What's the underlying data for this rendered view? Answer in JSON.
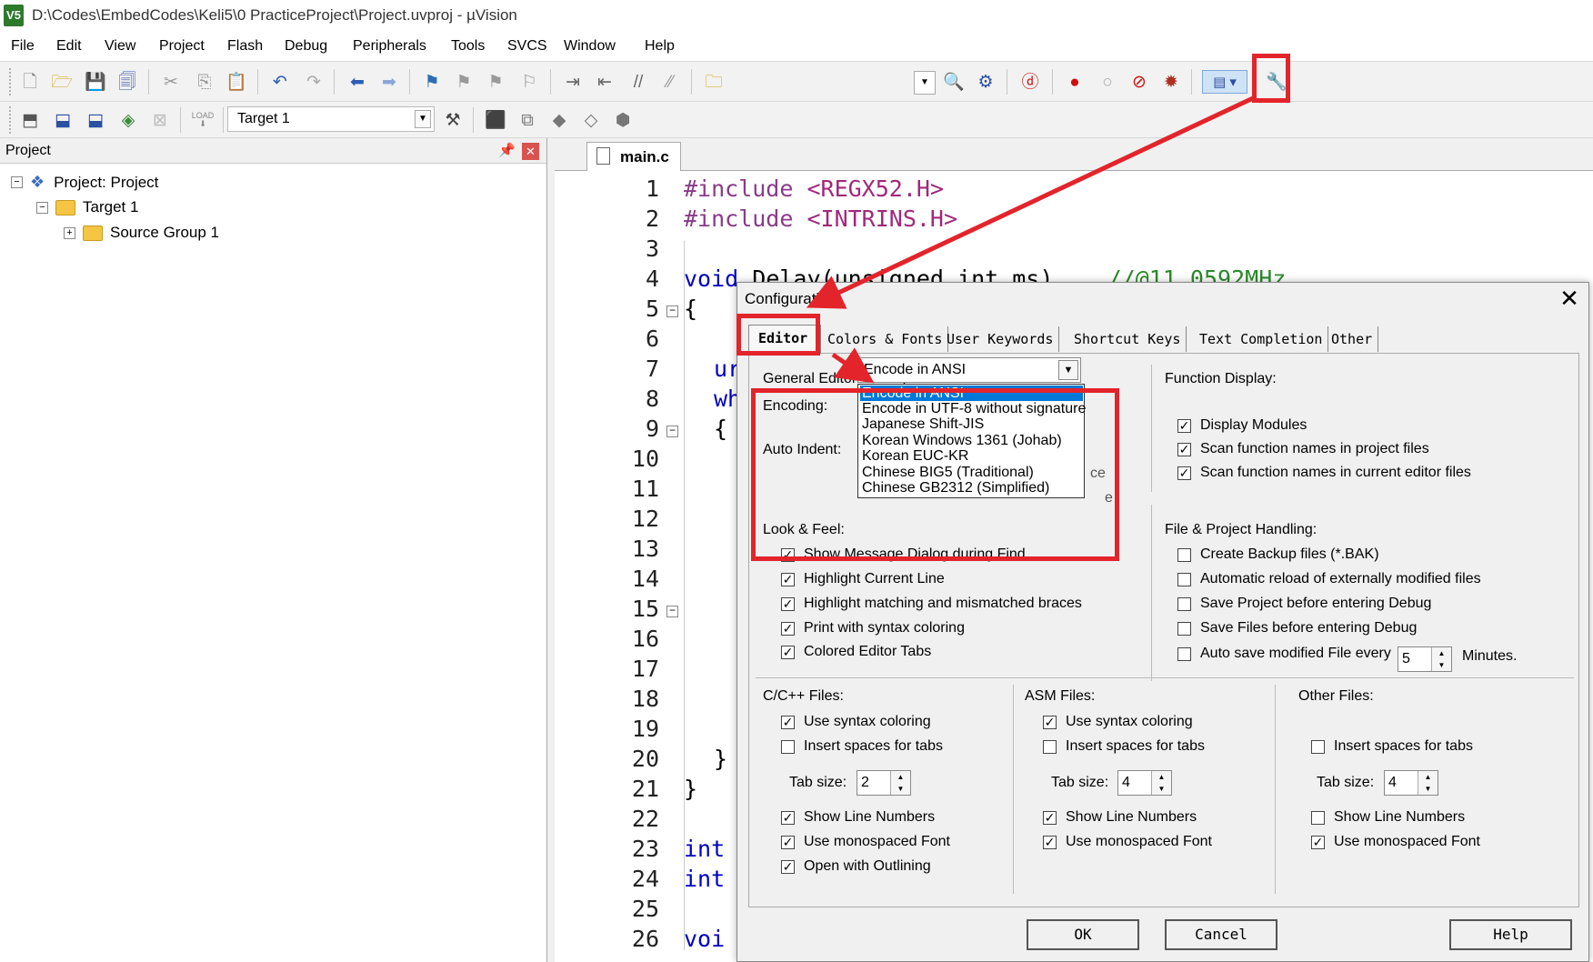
{
  "window": {
    "title": "D:\\Codes\\EmbedCodes\\Keli5\\0 PracticeProject\\Project.uvproj - µVision",
    "app_icon_text": "V5"
  },
  "menu": [
    "File",
    "Edit",
    "View",
    "Project",
    "Flash",
    "Debug",
    "Peripherals",
    "Tools",
    "SVCS",
    "Window",
    "Help"
  ],
  "toolbar2": {
    "target": "Target 1",
    "load_label": "LOAD"
  },
  "project_panel": {
    "title": "Project",
    "tree": [
      {
        "label": "Project: Project",
        "expander": "−"
      },
      {
        "label": "Target 1",
        "expander": "−"
      },
      {
        "label": "Source Group 1",
        "expander": "+"
      }
    ]
  },
  "editor": {
    "tab": "main.c",
    "line_numbers": [
      "1",
      "2",
      "3",
      "4",
      "5",
      "6",
      "7",
      "8",
      "9",
      "10",
      "11",
      "12",
      "13",
      "14",
      "15",
      "16",
      "17",
      "18",
      "19",
      "20",
      "21",
      "22",
      "23",
      "24",
      "25",
      "26"
    ],
    "code": {
      "l1_kw": "#include",
      "l1_rest": " <REGX52.H>",
      "l2_kw": "#include",
      "l2_rest": " <INTRINS.H>",
      "l4_kw": "void",
      "l4_rest": " Delay(unsigned int ms)",
      "l4_cmt": "//@11.0592MHz",
      "l5": "{",
      "l7": "ur",
      "l8": "wh",
      "l9": "{",
      "l20": "}",
      "l21": "}",
      "l23": "int",
      "l24": "int",
      "l26": "voi"
    }
  },
  "dialog": {
    "title": "Configuration",
    "close_glyph": "✕",
    "tabs": [
      "Editor",
      "Colors & Fonts",
      "User Keywords",
      "Shortcut Keys",
      "Text Completion",
      "Other"
    ],
    "general": {
      "title": "General Editor Settings:",
      "encoding_label": "Encoding:",
      "encoding_value": "Encode in ANSI",
      "auto_indent_label": "Auto Indent:",
      "encoding_options": [
        "Encode in ANSI",
        "Encode in UTF-8 without signature",
        "Japanese Shift-JIS",
        "Korean Windows 1361 (Johab)",
        "Korean EUC-KR",
        "Chinese BIG5 (Traditional)",
        "Chinese GB2312 (Simplified)"
      ],
      "partial_c": "ce",
      "partial_e": "e"
    },
    "function_display": {
      "title": "Function Display:",
      "items": [
        {
          "label": "Display Modules",
          "checked": true
        },
        {
          "label": "Scan function names in project files",
          "checked": true
        },
        {
          "label": "Scan function names in current editor files",
          "checked": true
        }
      ]
    },
    "look_feel": {
      "title": "Look & Feel:",
      "items": [
        {
          "label": "Show Message Dialog during Find",
          "checked": true
        },
        {
          "label": "Highlight Current Line",
          "checked": true
        },
        {
          "label": "Highlight matching and mismatched braces",
          "checked": true
        },
        {
          "label": "Print with syntax coloring",
          "checked": true
        },
        {
          "label": "Colored Editor Tabs",
          "checked": true
        }
      ]
    },
    "file_project": {
      "title": "File & Project Handling:",
      "items": [
        {
          "label": "Create Backup files (*.BAK)",
          "checked": false
        },
        {
          "label": "Automatic reload of externally modified files",
          "checked": false
        },
        {
          "label": "Save Project before entering Debug",
          "checked": false
        },
        {
          "label": "Save Files before entering Debug",
          "checked": false
        },
        {
          "label": "Auto save modified File every",
          "checked": false
        }
      ],
      "autosave_value": "5",
      "autosave_unit": "Minutes."
    },
    "cpp_files": {
      "title": "C/C++ Files:",
      "syntax": {
        "label": "Use syntax coloring",
        "checked": true
      },
      "spaces": {
        "label": "Insert spaces for tabs",
        "checked": false
      },
      "tab_label": "Tab size:",
      "tab_value": "2",
      "line_numbers": {
        "label": "Show Line Numbers",
        "checked": true
      },
      "mono": {
        "label": "Use monospaced Font",
        "checked": true
      },
      "outlining": {
        "label": "Open with Outlining",
        "checked": true
      }
    },
    "asm_files": {
      "title": "ASM Files:",
      "syntax": {
        "label": "Use syntax coloring",
        "checked": true
      },
      "spaces": {
        "label": "Insert spaces for tabs",
        "checked": false
      },
      "tab_label": "Tab size:",
      "tab_value": "4",
      "line_numbers": {
        "label": "Show Line Numbers",
        "checked": true
      },
      "mono": {
        "label": "Use monospaced Font",
        "checked": true
      }
    },
    "other_files": {
      "title": "Other Files:",
      "spaces": {
        "label": "Insert spaces for tabs",
        "checked": false
      },
      "tab_label": "Tab size:",
      "tab_value": "4",
      "line_numbers": {
        "label": "Show Line Numbers",
        "checked": false
      },
      "mono": {
        "label": "Use monospaced Font",
        "checked": true
      }
    },
    "buttons": {
      "ok": "OK",
      "cancel": "Cancel",
      "help": "Help"
    }
  },
  "colors": {
    "annotation_red": "#e3242b",
    "selection_blue": "#0078d7"
  }
}
